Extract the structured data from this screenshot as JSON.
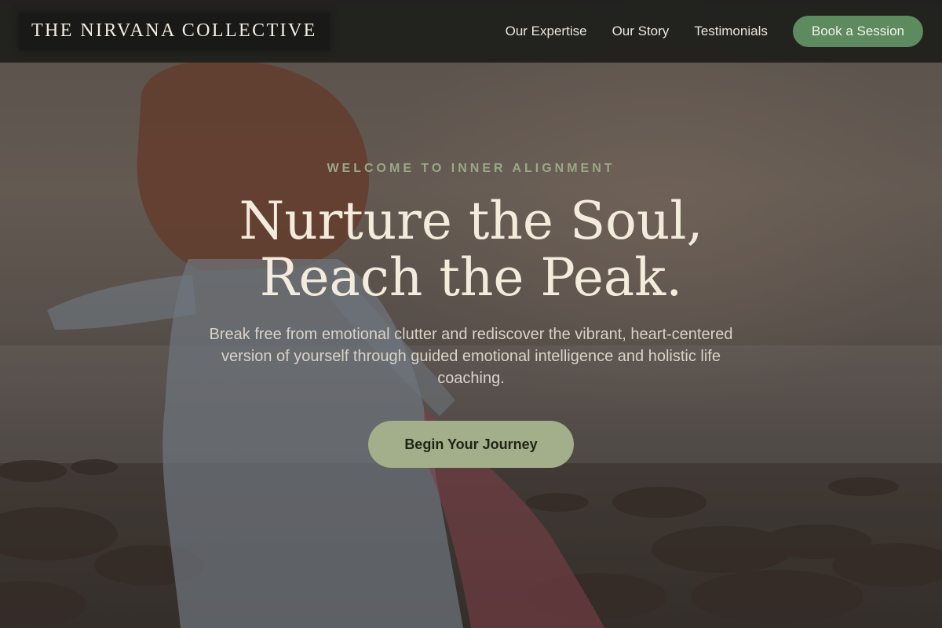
{
  "header": {
    "logo": "THE NIRVANA COLLECTIVE",
    "nav": [
      {
        "label": "Our Expertise"
      },
      {
        "label": "Our Story"
      },
      {
        "label": "Testimonials"
      }
    ],
    "cta_label": "Book a Session"
  },
  "hero": {
    "eyebrow": "WELCOME TO INNER ALIGNMENT",
    "headline_line1": "Nurture the Soul,",
    "headline_line2": "Reach the Peak.",
    "subtext": "Break free from emotional clutter and rediscover the vibrant, heart-centered version of yourself through guided emotional intelligence and holistic life coaching.",
    "button_label": "Begin Your Journey"
  },
  "colors": {
    "header_bg": "#1e1e1c",
    "accent_green": "#5d8a5e",
    "sage": "#a3ae8a",
    "eyebrow": "#9aa886",
    "headline": "#f3ebdc"
  }
}
